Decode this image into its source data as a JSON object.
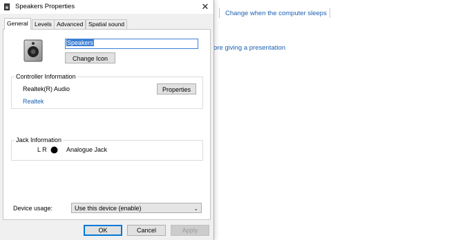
{
  "background": {
    "sleep_link": "Change when the computer sleeps",
    "presentation_link": "ore giving a presentation"
  },
  "dialog": {
    "title": "Speakers Properties",
    "close_glyph": "✕",
    "tabs": [
      {
        "label": "General",
        "active": true
      },
      {
        "label": "Levels",
        "active": false
      },
      {
        "label": "Advanced",
        "active": false
      },
      {
        "label": "Spatial sound",
        "active": false
      }
    ],
    "device_name": "Speakers",
    "change_icon_label": "Change Icon",
    "controller": {
      "group_title": "Controller Information",
      "name": "Realtek(R) Audio",
      "properties_label": "Properties",
      "vendor_link": "Realtek"
    },
    "jack": {
      "group_title": "Jack Information",
      "channels": "L R",
      "type": "Analogue Jack",
      "jack_color": "#000000"
    },
    "device_usage": {
      "label": "Device usage:",
      "value": "Use this device (enable)",
      "chevron": "⌄"
    },
    "buttons": {
      "ok": "OK",
      "cancel": "Cancel",
      "apply": "Apply"
    }
  },
  "colors": {
    "link": "#1a5fb4",
    "selection": "#3c7fd4",
    "focus": "#0078d7"
  },
  "icons": {
    "title": "speaker-icon",
    "device": "speaker-icon",
    "close": "close-icon",
    "jack": "jack-dot-icon",
    "dropdown": "chevron-down-icon"
  }
}
